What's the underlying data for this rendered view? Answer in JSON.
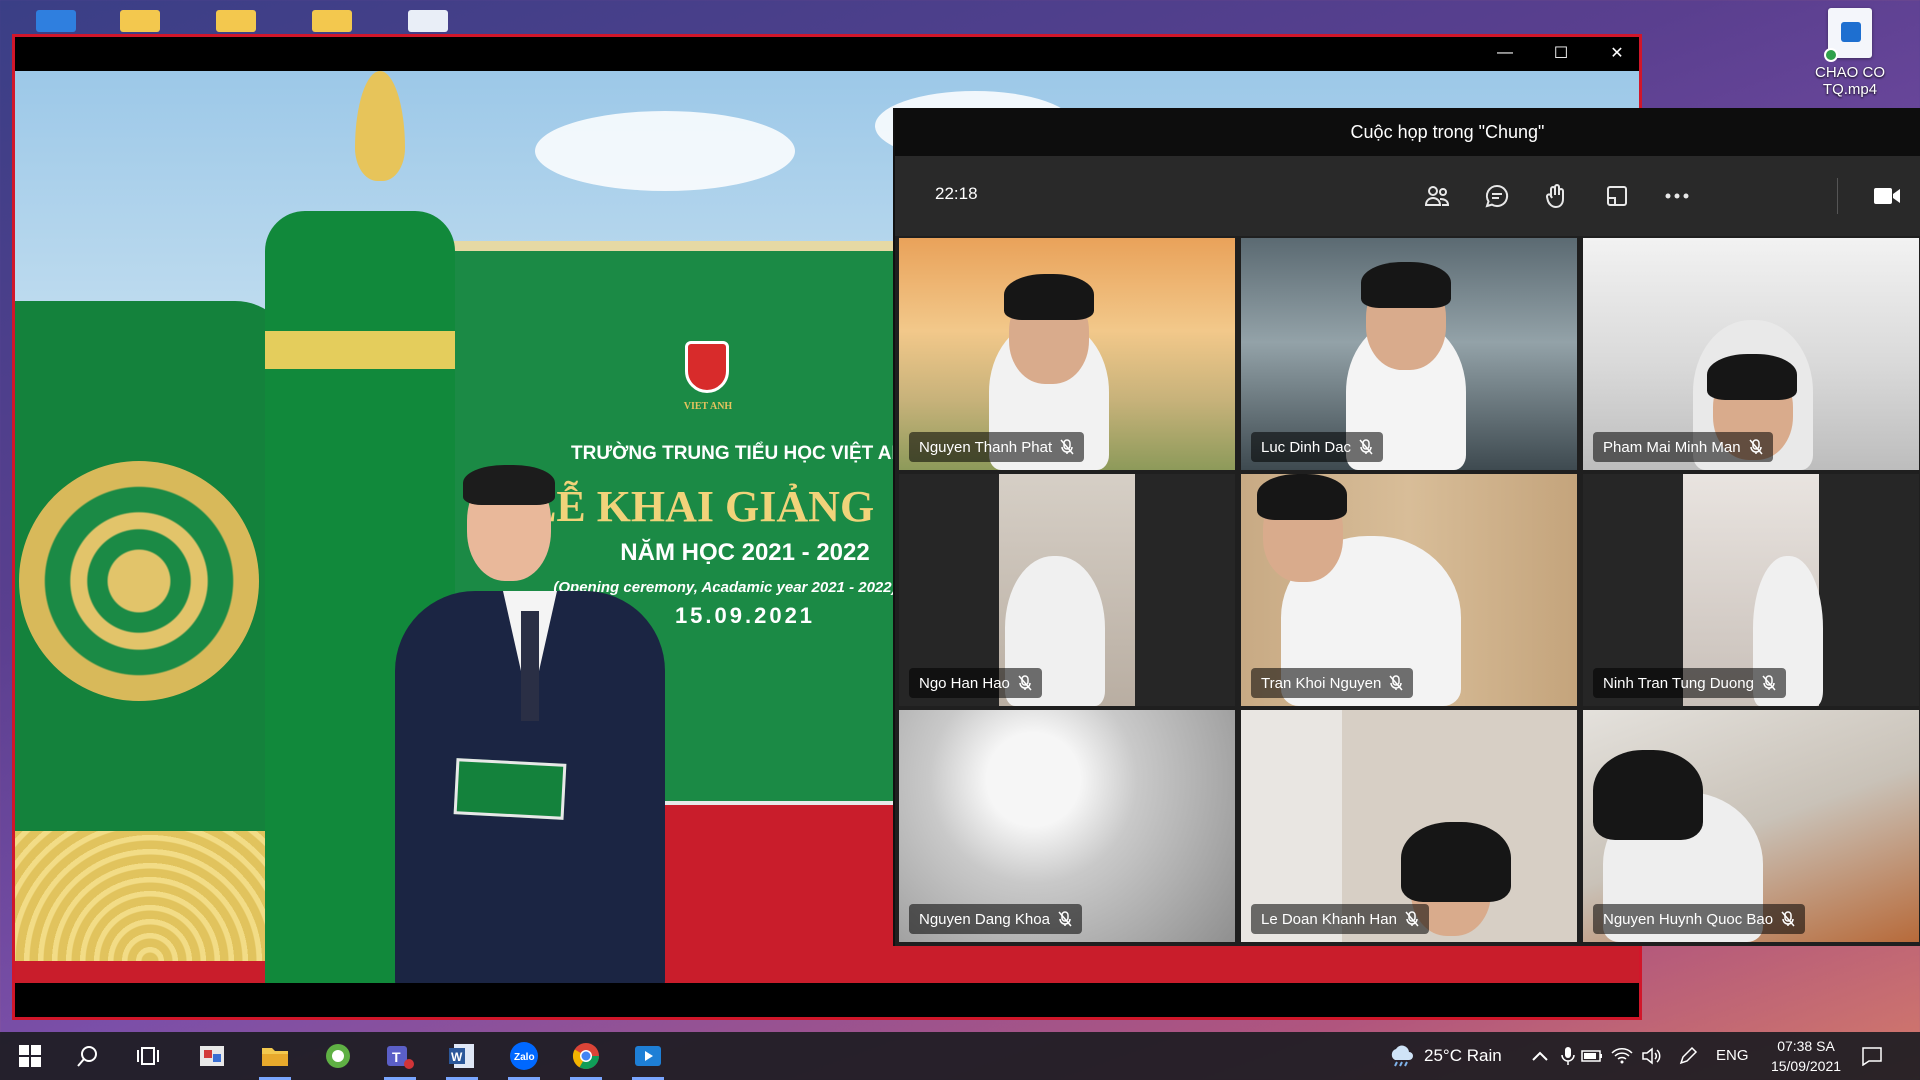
{
  "desktop": {
    "file_icon_label_line1": "CHAO CO",
    "file_icon_label_line2": "TQ.mp4"
  },
  "video_window": {
    "stage": {
      "logo_text": "VIET ANH",
      "school_name": "TRƯỜNG TRUNG TIỂU HỌC VIỆT ANH",
      "event_title": "LỄ KHAI GIẢNG",
      "school_year": "NĂM HỌC 2021 - 2022",
      "english_subtitle": "(Opening ceremony, Acadamic year 2021 - 2022)",
      "date": "15.09.2021"
    },
    "controls": {
      "minimize": "—",
      "maximize": "☐",
      "close": "✕"
    }
  },
  "teams": {
    "meeting_title": "Cuộc họp trong \"Chung\"",
    "call_duration": "22:18",
    "toolbar_icons": [
      "people-icon",
      "chat-icon",
      "raise-hand-icon",
      "share-icon",
      "more-icon",
      "camera-icon"
    ],
    "participants": [
      {
        "name": "Nguyen Thanh Phat",
        "muted": true
      },
      {
        "name": "Luc Dinh Dac",
        "muted": true
      },
      {
        "name": "Pham Mai Minh Man",
        "muted": true
      },
      {
        "name": "Ngo Han Hao",
        "muted": true
      },
      {
        "name": "Tran Khoi Nguyen",
        "muted": true
      },
      {
        "name": "Ninh Tran Tung Duong",
        "muted": true
      },
      {
        "name": "Nguyen Dang Khoa",
        "muted": true
      },
      {
        "name": "Le Doan Khanh Han",
        "muted": true
      },
      {
        "name": "Nguyen Huynh Quoc Bao",
        "muted": true
      }
    ]
  },
  "taskbar": {
    "apps": [
      "start-icon",
      "search-icon",
      "task-view-icon",
      "snipping-tool-icon",
      "file-explorer-icon",
      "camtasia-icon",
      "teams-icon",
      "word-icon",
      "zalo-icon",
      "chrome-icon",
      "media-player-icon"
    ],
    "zalo_label": "Zalo",
    "word_label": "W",
    "weather": "25°C  Rain",
    "language": "ENG",
    "time": "07:38 SA",
    "date": "15/09/2021"
  },
  "colors": {
    "window_border": "#d1162a",
    "teams_bg": "#1f1f1f",
    "stage_green": "#1b8a45",
    "gold": "#e6c45e"
  }
}
